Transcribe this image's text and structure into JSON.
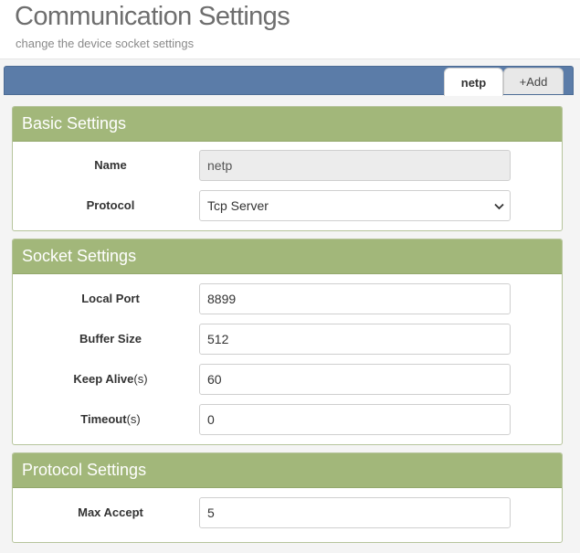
{
  "header": {
    "title": "Communication Settings",
    "subtitle": "change the device socket settings"
  },
  "tabs": {
    "active_label": "netp",
    "add_label": "+Add"
  },
  "basic": {
    "title": "Basic Settings",
    "name_label": "Name",
    "name_value": "netp",
    "protocol_label": "Protocol",
    "protocol_value": "Tcp Server"
  },
  "socket": {
    "title": "Socket Settings",
    "local_port_label": "Local Port",
    "local_port_value": "8899",
    "buffer_size_label": "Buffer Size",
    "buffer_size_value": "512",
    "keep_alive_label": "Keep Alive",
    "keep_alive_unit": "(s)",
    "keep_alive_value": "60",
    "timeout_label": "Timeout",
    "timeout_unit": "(s)",
    "timeout_value": "0"
  },
  "protocol": {
    "title": "Protocol Settings",
    "max_accept_label": "Max Accept",
    "max_accept_value": "5"
  },
  "icons": {
    "select_arrow": "chevron-down-icon"
  }
}
